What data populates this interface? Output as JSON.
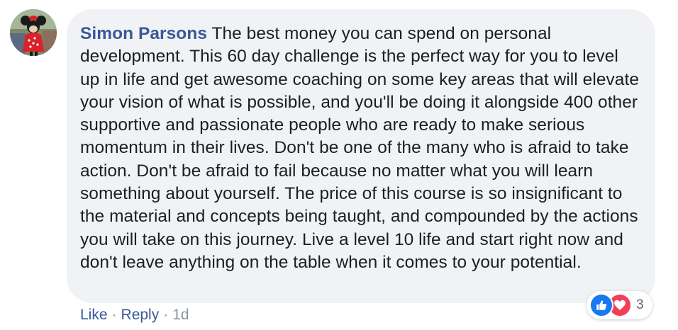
{
  "comment": {
    "author": "Simon Parsons",
    "text": "The best money you can spend on personal development. This 60 day challenge is the perfect way for you to level up in life and get awesome coaching on some key areas that will elevate your vision of what is possible, and you'll be doing it alongside 400 other supportive and passionate people who are ready to make serious momentum in their lives. Don't be one of the many who is afraid to take action. Don't be afraid to fail because no matter what you will learn something about yourself. The price of this course is so insignificant to the material and concepts being taught, and compounded by the actions you will take on this journey. Live a level 10 life and start right now and don't leave anything on the table when it comes to your potential."
  },
  "actions": {
    "like_label": "Like",
    "separator": "·",
    "reply_label": "Reply",
    "timestamp": "1d"
  },
  "reactions": {
    "count": "3",
    "types": [
      "like-icon",
      "love-icon"
    ],
    "like_color": "#1877f2",
    "love_color": "#f33e58"
  },
  "colors": {
    "bubble_bg": "#f0f2f5",
    "author": "#385898",
    "text": "#1c1e21",
    "meta": "#8d949e"
  }
}
